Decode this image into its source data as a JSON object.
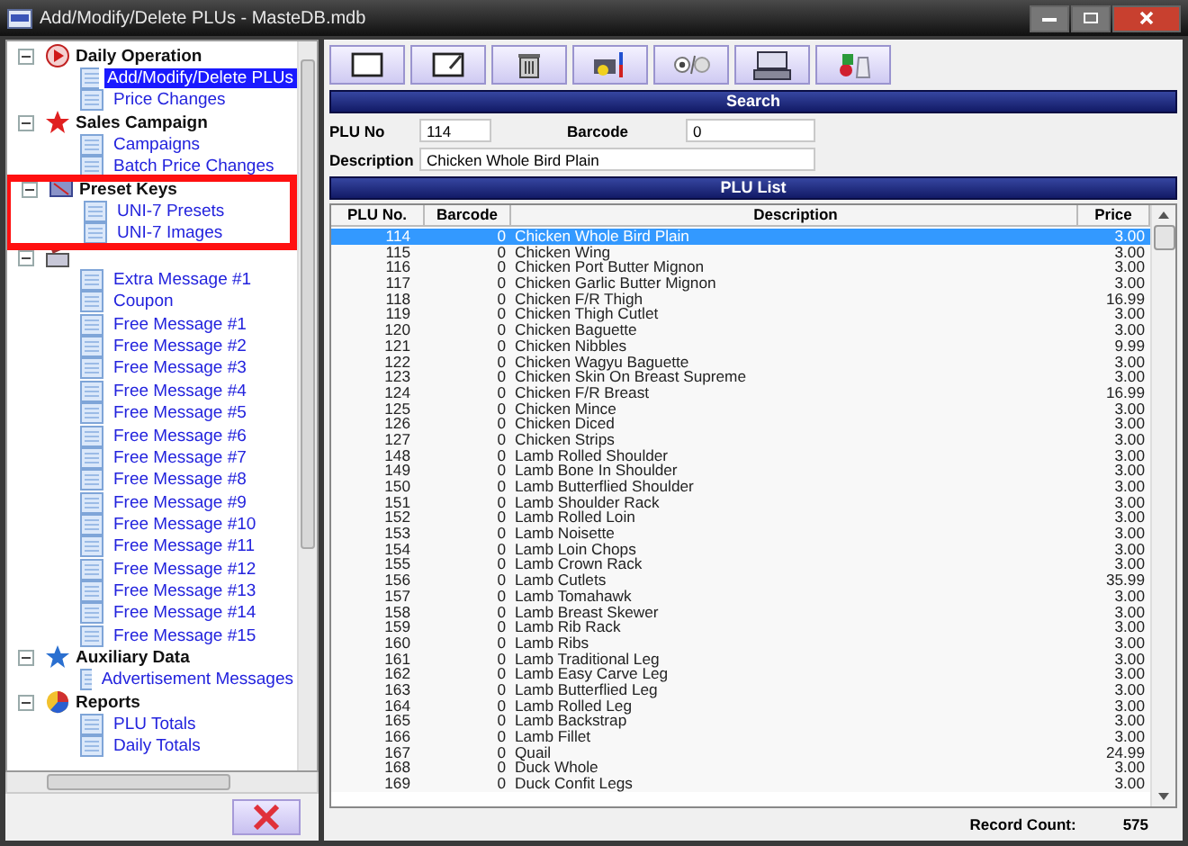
{
  "window": {
    "title": "Add/Modify/Delete PLUs - MasteDB.mdb"
  },
  "sidebar": {
    "groups": [
      {
        "label": "Daily Operation",
        "expanded": true,
        "children": [
          {
            "label": "Add/Modify/Delete PLUs",
            "selected": true
          },
          {
            "label": "Price Changes",
            "selected": false
          }
        ]
      },
      {
        "label": "Sales Campaign",
        "expanded": true,
        "children": [
          {
            "label": "Campaigns",
            "selected": false
          },
          {
            "label": "Batch Price Changes",
            "selected": false
          }
        ]
      },
      {
        "label": "Preset Keys",
        "expanded": true,
        "highlighted": true,
        "children": [
          {
            "label": "UNI-7 Presets",
            "selected": false
          },
          {
            "label": "UNI-7 Images",
            "selected": false
          }
        ]
      },
      {
        "expanded": true,
        "children": [
          {
            "label": "Extra Message #1",
            "selected": false
          },
          {
            "label": "Coupon",
            "selected": false
          },
          {
            "label": "Free Message #1",
            "selected": false
          },
          {
            "label": "Free Message #2",
            "selected": false
          },
          {
            "label": "Free Message #3",
            "selected": false
          },
          {
            "label": "Free Message #4",
            "selected": false
          },
          {
            "label": "Free Message #5",
            "selected": false
          },
          {
            "label": "Free Message #6",
            "selected": false
          },
          {
            "label": "Free Message #7",
            "selected": false
          },
          {
            "label": "Free Message #8",
            "selected": false
          },
          {
            "label": "Free Message #9",
            "selected": false
          },
          {
            "label": "Free Message #10",
            "selected": false
          },
          {
            "label": "Free Message #11",
            "selected": false
          },
          {
            "label": "Free Message #12",
            "selected": false
          },
          {
            "label": "Free Message #13",
            "selected": false
          },
          {
            "label": "Free Message #14",
            "selected": false
          },
          {
            "label": "Free Message #15",
            "selected": false
          }
        ]
      },
      {
        "label": "Auxiliary Data",
        "expanded": true,
        "children": [
          {
            "label": "Advertisement Messages",
            "selected": false
          }
        ]
      },
      {
        "label": "Reports",
        "expanded": true,
        "children": [
          {
            "label": "PLU Totals",
            "selected": false
          },
          {
            "label": "Daily Totals",
            "selected": false
          }
        ]
      }
    ]
  },
  "search": {
    "title": "Search",
    "plu_no_label": "PLU No",
    "plu_no": "114",
    "barcode_label": "Barcode",
    "barcode": "0",
    "description_label": "Description",
    "description": "Chicken Whole Bird Plain"
  },
  "plu_list": {
    "title": "PLU List",
    "columns": [
      "PLU No.",
      "Barcode",
      "Description",
      "Price"
    ],
    "rows": [
      {
        "plu": "114",
        "barcode": "0",
        "description": "Chicken Whole Bird Plain",
        "price": "3.00",
        "selected": true
      },
      {
        "plu": "115",
        "barcode": "0",
        "description": "Chicken Wing",
        "price": "3.00",
        "selected": false
      },
      {
        "plu": "116",
        "barcode": "0",
        "description": "Chicken Port Butter Mignon",
        "price": "3.00",
        "selected": false
      },
      {
        "plu": "117",
        "barcode": "0",
        "description": "Chicken Garlic Butter Mignon",
        "price": "3.00",
        "selected": false
      },
      {
        "plu": "118",
        "barcode": "0",
        "description": "Chicken F/R Thigh",
        "price": "16.99",
        "selected": false
      },
      {
        "plu": "119",
        "barcode": "0",
        "description": "Chicken Thigh Cutlet",
        "price": "3.00",
        "selected": false
      },
      {
        "plu": "120",
        "barcode": "0",
        "description": "Chicken Baguette",
        "price": "3.00",
        "selected": false
      },
      {
        "plu": "121",
        "barcode": "0",
        "description": "Chicken Nibbles",
        "price": "9.99",
        "selected": false
      },
      {
        "plu": "122",
        "barcode": "0",
        "description": "Chicken Wagyu Baguette",
        "price": "3.00",
        "selected": false
      },
      {
        "plu": "123",
        "barcode": "0",
        "description": "Chicken Skin On Breast Supreme",
        "price": "3.00",
        "selected": false
      },
      {
        "plu": "124",
        "barcode": "0",
        "description": "Chicken F/R Breast",
        "price": "16.99",
        "selected": false
      },
      {
        "plu": "125",
        "barcode": "0",
        "description": "Chicken Mince",
        "price": "3.00",
        "selected": false
      },
      {
        "plu": "126",
        "barcode": "0",
        "description": "Chicken Diced",
        "price": "3.00",
        "selected": false
      },
      {
        "plu": "127",
        "barcode": "0",
        "description": "Chicken Strips",
        "price": "3.00",
        "selected": false
      },
      {
        "plu": "148",
        "barcode": "0",
        "description": "Lamb Rolled Shoulder",
        "price": "3.00",
        "selected": false
      },
      {
        "plu": "149",
        "barcode": "0",
        "description": "Lamb Bone In Shoulder",
        "price": "3.00",
        "selected": false
      },
      {
        "plu": "150",
        "barcode": "0",
        "description": "Lamb Butterflied Shoulder",
        "price": "3.00",
        "selected": false
      },
      {
        "plu": "151",
        "barcode": "0",
        "description": "Lamb Shoulder Rack",
        "price": "3.00",
        "selected": false
      },
      {
        "plu": "152",
        "barcode": "0",
        "description": "Lamb Rolled Loin",
        "price": "3.00",
        "selected": false
      },
      {
        "plu": "153",
        "barcode": "0",
        "description": "Lamb Noisette",
        "price": "3.00",
        "selected": false
      },
      {
        "plu": "154",
        "barcode": "0",
        "description": "Lamb Loin Chops",
        "price": "3.00",
        "selected": false
      },
      {
        "plu": "155",
        "barcode": "0",
        "description": "Lamb Crown Rack",
        "price": "3.00",
        "selected": false
      },
      {
        "plu": "156",
        "barcode": "0",
        "description": "Lamb Cutlets",
        "price": "35.99",
        "selected": false
      },
      {
        "plu": "157",
        "barcode": "0",
        "description": "Lamb Tomahawk",
        "price": "3.00",
        "selected": false
      },
      {
        "plu": "158",
        "barcode": "0",
        "description": "Lamb Breast Skewer",
        "price": "3.00",
        "selected": false
      },
      {
        "plu": "159",
        "barcode": "0",
        "description": "Lamb Rib Rack",
        "price": "3.00",
        "selected": false
      },
      {
        "plu": "160",
        "barcode": "0",
        "description": "Lamb Ribs",
        "price": "3.00",
        "selected": false
      },
      {
        "plu": "161",
        "barcode": "0",
        "description": "Lamb Traditional Leg",
        "price": "3.00",
        "selected": false
      },
      {
        "plu": "162",
        "barcode": "0",
        "description": "Lamb Easy Carve Leg",
        "price": "3.00",
        "selected": false
      },
      {
        "plu": "163",
        "barcode": "0",
        "description": "Lamb Butterflied Leg",
        "price": "3.00",
        "selected": false
      },
      {
        "plu": "164",
        "barcode": "0",
        "description": "Lamb Rolled Leg",
        "price": "3.00",
        "selected": false
      },
      {
        "plu": "165",
        "barcode": "0",
        "description": "Lamb Backstrap",
        "price": "3.00",
        "selected": false
      },
      {
        "plu": "166",
        "barcode": "0",
        "description": "Lamb Fillet",
        "price": "3.00",
        "selected": false
      },
      {
        "plu": "167",
        "barcode": "0",
        "description": "Quail",
        "price": "24.99",
        "selected": false
      },
      {
        "plu": "168",
        "barcode": "0",
        "description": "Duck Whole",
        "price": "3.00",
        "selected": false
      },
      {
        "plu": "169",
        "barcode": "0",
        "description": "Duck Confit Legs",
        "price": "3.00",
        "selected": false
      }
    ]
  },
  "status_bar": {
    "record_count_label": "Record Count:",
    "record_count": "575"
  }
}
